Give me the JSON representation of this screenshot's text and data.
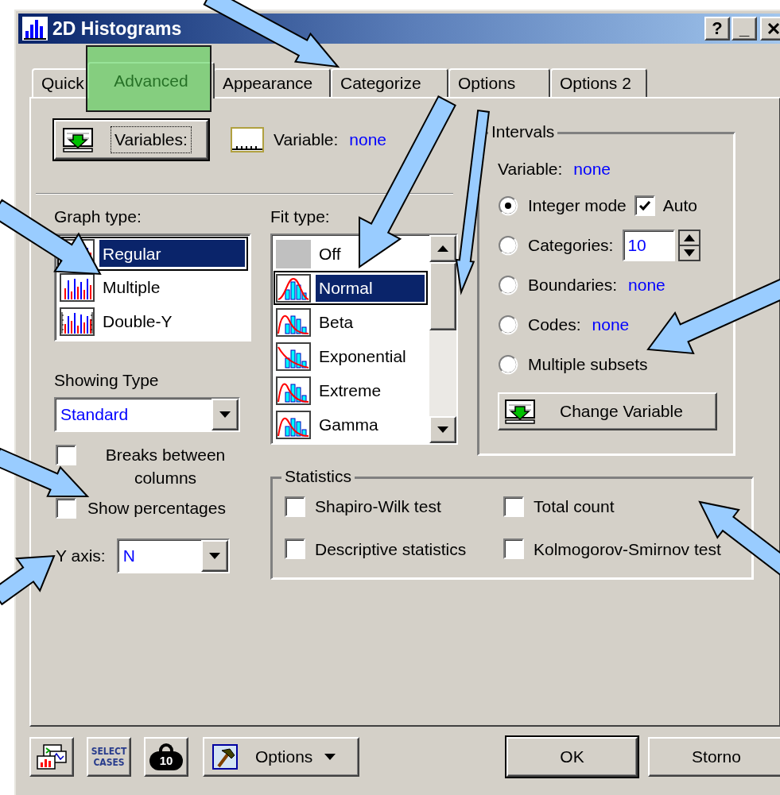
{
  "window": {
    "title": "2D Histograms",
    "title_buttons": [
      "?",
      "_"
    ]
  },
  "tabs": [
    {
      "label": "Quick",
      "selected": false
    },
    {
      "label": "Advanced",
      "selected": true
    },
    {
      "label": "Appearance",
      "selected": false
    },
    {
      "label": "Categorize",
      "selected": false
    },
    {
      "label": "Options",
      "selected": false
    },
    {
      "label": "Options 2",
      "selected": false
    }
  ],
  "variables_button": "Variables:",
  "variable": {
    "label": "Variable:",
    "value": "none"
  },
  "graph_type": {
    "label": "Graph type:",
    "items": [
      {
        "kind": "regular",
        "label": "Regular",
        "selected": true
      },
      {
        "kind": "multiple",
        "label": "Multiple",
        "selected": false
      },
      {
        "kind": "double_y",
        "label": "Double-Y",
        "selected": false
      }
    ]
  },
  "fit_type": {
    "label": "Fit type:",
    "items": [
      {
        "kind": "off",
        "label": "Off",
        "selected": false
      },
      {
        "kind": "normal",
        "label": "Normal",
        "selected": true
      },
      {
        "kind": "beta",
        "label": "Beta",
        "selected": false
      },
      {
        "kind": "exponential",
        "label": "Exponential",
        "selected": false
      },
      {
        "kind": "extreme",
        "label": "Extreme",
        "selected": false
      },
      {
        "kind": "gamma",
        "label": "Gamma",
        "selected": false
      }
    ]
  },
  "showing_type": {
    "label": "Showing Type",
    "value": "Standard"
  },
  "checkboxes": [
    {
      "label": "Breaks between columns",
      "checked": false
    },
    {
      "label": "Show percentages",
      "checked": false
    }
  ],
  "y_axis": {
    "label": "Y axis:",
    "value": "N"
  },
  "intervals": {
    "title": "Intervals",
    "variable": {
      "label": "Variable:",
      "value": "none"
    },
    "options": [
      {
        "kind": "integer",
        "label": "Integer mode",
        "selected": true,
        "auto": {
          "label": "Auto",
          "checked": true
        }
      },
      {
        "kind": "spin",
        "label": "Categories:",
        "value": "10",
        "selected": false
      },
      {
        "kind": "value",
        "label": "Boundaries:",
        "value": "none",
        "selected": false
      },
      {
        "kind": "value",
        "label": "Codes:",
        "value": "none",
        "selected": false
      },
      {
        "kind": "plain",
        "label": "Multiple subsets",
        "selected": false
      }
    ],
    "button": "Change Variable"
  },
  "statistics": {
    "title": "Statistics",
    "items": [
      {
        "label": "Shapiro-Wilk test",
        "checked": false
      },
      {
        "label": "Total count",
        "checked": false
      },
      {
        "label": "Descriptive statistics",
        "checked": false
      },
      {
        "label": "Kolmogorov-Smirnov test",
        "checked": false
      }
    ]
  },
  "toolbar": {
    "select_cases": "SELECT CASES",
    "weight": "10",
    "options": "Options"
  },
  "buttons": {
    "ok": "OK",
    "cancel": "Storno"
  }
}
